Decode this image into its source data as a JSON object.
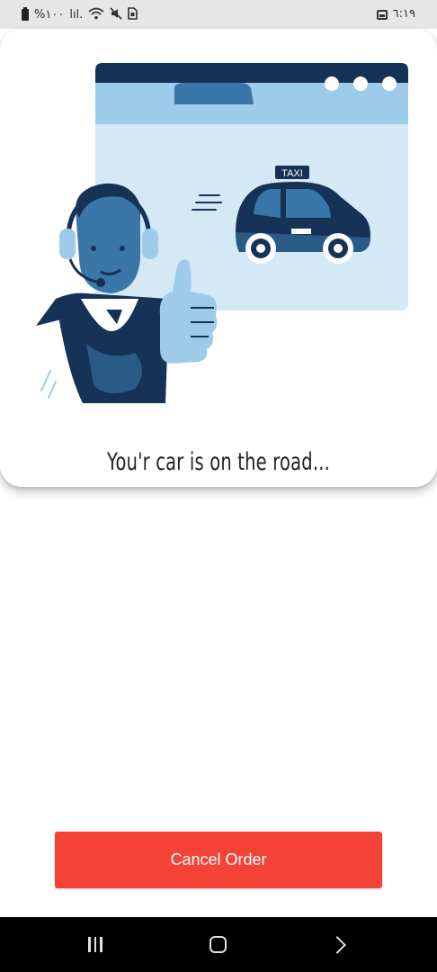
{
  "status_bar": {
    "battery_text": "%١٠٠",
    "signal_text": "lıl.",
    "time": "٦:١٩"
  },
  "card": {
    "message": "You'r car is on the road...",
    "illustration": {
      "taxi_sign": "TAXI"
    }
  },
  "actions": {
    "cancel_label": "Cancel Order",
    "cancel_color": "#f44336"
  },
  "colors": {
    "navy": "#163256",
    "light_blue": "#d4e9f6",
    "mid_blue": "#9fcbea"
  },
  "nav_bar": {
    "recents_icon": "recents-icon",
    "home_icon": "home-icon",
    "back_icon": "back-icon"
  }
}
